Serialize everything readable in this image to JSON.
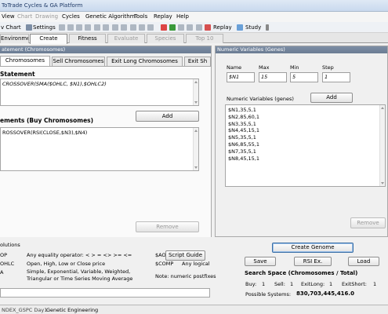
{
  "app": {
    "title": "ToTrade Cycles & GA Platform"
  },
  "menu": [
    {
      "label": "View",
      "enabled": true
    },
    {
      "label": "Chart",
      "enabled": false
    },
    {
      "label": "Drawing",
      "enabled": false
    },
    {
      "label": "Cycles",
      "enabled": true
    },
    {
      "label": "Genetic Algorithm",
      "enabled": true
    },
    {
      "label": "Tools",
      "enabled": true
    },
    {
      "label": "Replay",
      "enabled": true
    },
    {
      "label": "Help",
      "enabled": true
    }
  ],
  "toolbar": {
    "new_chart": "v Chart",
    "settings": "Settings",
    "replay": "Replay",
    "study": "Study"
  },
  "tabs": [
    {
      "label": "Environment",
      "state": "normal"
    },
    {
      "label": "Create",
      "state": "active"
    },
    {
      "label": "Fitness",
      "state": "normal"
    },
    {
      "label": "Evaluate",
      "state": "disabled"
    },
    {
      "label": "Species",
      "state": "disabled"
    },
    {
      "label": "Top 10",
      "state": "disabled"
    }
  ],
  "left": {
    "group_title": "atement (Chromosomes)",
    "subtabs": [
      "Chromosomes",
      "Sell Chromosomes",
      "Exit Long Chromosomes",
      "Exit Sh"
    ],
    "statement_heading": "Statement",
    "statement_text": "CROSSOVER(SMA($OHLC, $N1),$OHLC2)",
    "add_label": "Add",
    "elements_heading": "ements (Buy Chromosomes)",
    "elements": [
      "ROSSOVER(RSI(CLOSE,$N3),$N4)"
    ],
    "remove_label": "Remove"
  },
  "right": {
    "group_title": "Numeric Variables (Genes)",
    "name_label": "Name",
    "max_label": "Max",
    "min_label": "Min",
    "step_label": "Step",
    "name_value": "$N1",
    "max_value": "15",
    "min_value": "5",
    "step_value": "1",
    "add_label": "Add",
    "list_label": "Numeric Variables (genes)",
    "genes": [
      "$N1,35,5,1",
      "$N2,85,60,1",
      "$N3,35,5,1",
      "$N4,45,15,1",
      "$N5,35,5,1",
      "$N6,85,55,1",
      "$N7,35,5,1",
      "$N8,45,15,1"
    ],
    "remove_label": "Remove"
  },
  "bottom": {
    "solutions_title": "olutions",
    "rows": [
      {
        "key": "OP",
        "desc": "Any equality operator: <  >  =  <>  >=  <="
      },
      {
        "key": "OHLC",
        "desc": "Open, High, Low or Close price"
      },
      {
        "key": "A",
        "desc": "Simple, Exponential, Variable, Weighted, Triangular or Time Series Moving Average"
      }
    ],
    "ao_label": "$AO",
    "comp_label": "$COMP",
    "comp_desc": "Any logical",
    "script_guide": "Script Guide",
    "note": "Note: numeric postfixes",
    "create_genome": "Create Genome",
    "save": "Save",
    "rsi_ex": "RSI Ex.",
    "load": "Load",
    "search_title": "Search Space (Chromosomes / Total)",
    "buy_label": "Buy:",
    "buy_value": "1",
    "sell_label": "Sell:",
    "sell_value": "1",
    "exitlong_label": "ExitLong:",
    "exitlong_value": "1",
    "exitshort_label": "ExitShort:",
    "exitshort_value": "1",
    "possible_label": "Possible Systems:",
    "possible_value": "830,703,445,416.0"
  },
  "status": {
    "symbol": "NDEX_GSPC Day1",
    "section": "Genetic Engineering"
  }
}
